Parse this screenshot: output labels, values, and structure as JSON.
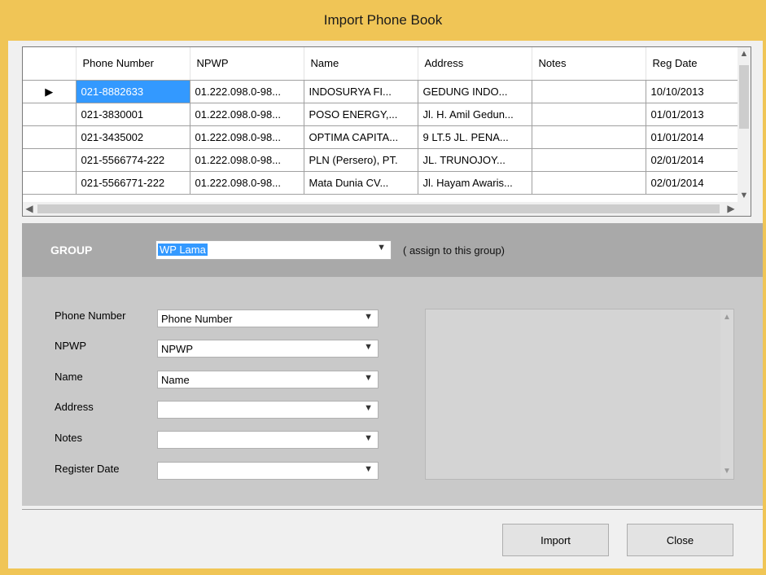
{
  "window": {
    "title": "Import Phone Book"
  },
  "grid": {
    "columns": [
      "Phone Number",
      "NPWP",
      "Name",
      "Address",
      "Notes",
      "Reg Date"
    ],
    "rows": [
      {
        "phone": "021-8882633",
        "npwp": "01.222.098.0-98...",
        "name": "INDOSURYA FI...",
        "address": "GEDUNG INDO...",
        "notes": "",
        "reg_date": "10/10/2013"
      },
      {
        "phone": "021-3830001",
        "npwp": "01.222.098.0-98...",
        "name": "POSO ENERGY,...",
        "address": "Jl. H. Amil Gedun...",
        "notes": "",
        "reg_date": "01/01/2013"
      },
      {
        "phone": "021-3435002",
        "npwp": "01.222.098.0-98...",
        "name": "OPTIMA CAPITA...",
        "address": "9 LT.5 JL. PENA...",
        "notes": "",
        "reg_date": "01/01/2014"
      },
      {
        "phone": "021-5566774-222",
        "npwp": "01.222.098.0-98...",
        "name": "PLN (Persero), PT.",
        "address": "JL. TRUNOJOY...",
        "notes": "",
        "reg_date": "02/01/2014"
      },
      {
        "phone": "021-5566771-222",
        "npwp": "01.222.098.0-98...",
        "name": "Mata Dunia CV...",
        "address": "Jl. Hayam Awaris...",
        "notes": "",
        "reg_date": "02/01/2014"
      }
    ],
    "current_row_marker": "▶"
  },
  "group": {
    "label": "GROUP",
    "selected": "WP Lama",
    "hint": "( assign to this group)"
  },
  "mapping": {
    "fields": [
      {
        "label": "Phone Number",
        "value": "Phone Number"
      },
      {
        "label": "NPWP",
        "value": "NPWP"
      },
      {
        "label": "Name",
        "value": "Name"
      },
      {
        "label": "Address",
        "value": ""
      },
      {
        "label": "Notes",
        "value": ""
      },
      {
        "label": "Register Date",
        "value": ""
      }
    ]
  },
  "buttons": {
    "import": "Import",
    "close": "Close"
  },
  "icons": {
    "dropdown": "chevron-down-icon",
    "scroll_up": "scroll-up-icon",
    "scroll_down": "scroll-down-icon",
    "scroll_left": "scroll-left-icon",
    "scroll_right": "scroll-right-icon"
  },
  "colors": {
    "title_bar": "#f0c556",
    "selection": "#3399ff",
    "group_band": "#a9a9a9",
    "panel": "#c9c9c9"
  }
}
